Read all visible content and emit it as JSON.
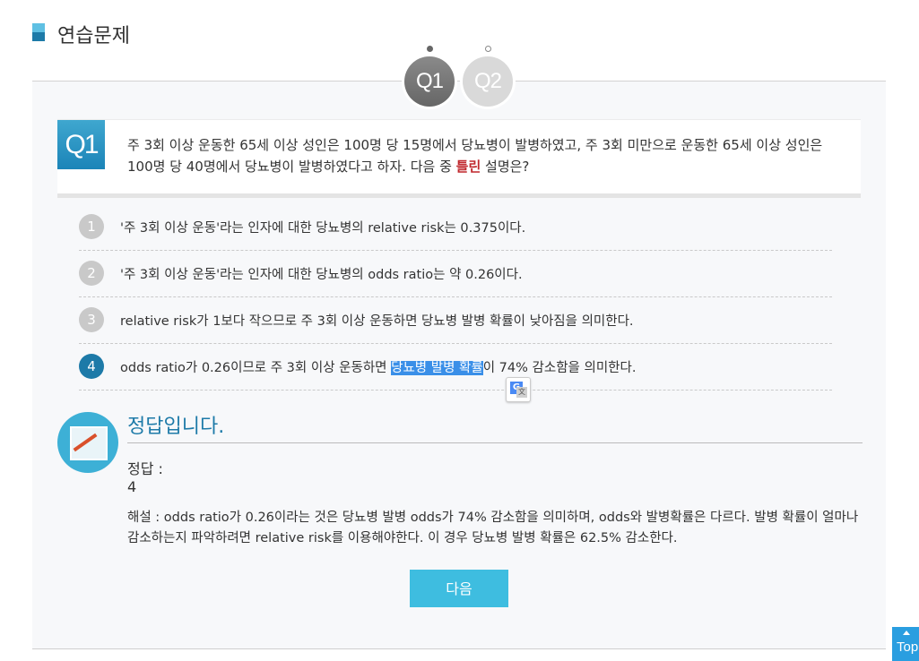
{
  "header": {
    "title": "연습문제"
  },
  "nav": {
    "q1": "Q1",
    "q2": "Q2"
  },
  "question": {
    "badge": "Q1",
    "text_before": "주 3회 이상 운동한 65세 이상 성인은 100명 당 15명에서 당뇨병이 발병하였고, 주 3회 미만으로 운동한 65세 이상 성인은 100명 당 40명에서 당뇨병이 발병하였다고 하자. 다음 중 ",
    "emphasis": "틀린",
    "text_after": " 설명은?"
  },
  "options": [
    {
      "num": "1",
      "text": "'주 3회 이상 운동'라는 인자에 대한 당뇨병의 relative risk는 0.375이다."
    },
    {
      "num": "2",
      "text": "'주 3회 이상 운동'라는 인자에 대한 당뇨병의 odds ratio는 약 0.26이다."
    },
    {
      "num": "3",
      "text": "relative risk가 1보다 작으므로 주 3회 이상 운동하면 당뇨병 발병 확률이 낮아짐을 의미한다."
    },
    {
      "num": "4",
      "text_before": "odds ratio가 0.26이므로 주 3회 이상 운동하면 ",
      "highlight": "당뇨병 발병 확률",
      "text_after": "이 74% 감소함을 의미한다."
    }
  ],
  "answer": {
    "title": "정답입니다.",
    "label": "정답 :",
    "value": "4",
    "explanation": "해설 : odds ratio가 0.26이라는 것은 당뇨병 발병 odds가 74% 감소함을 의미하며, odds와 발병확률은 다르다. 발병 확률이 얼마나 감소하는지 파악하려면 relative risk를 이용해야한다. 이 경우 당뇨병 발병 확률은 62.5% 감소한다."
  },
  "next_button": "다음",
  "top_button": "Top"
}
